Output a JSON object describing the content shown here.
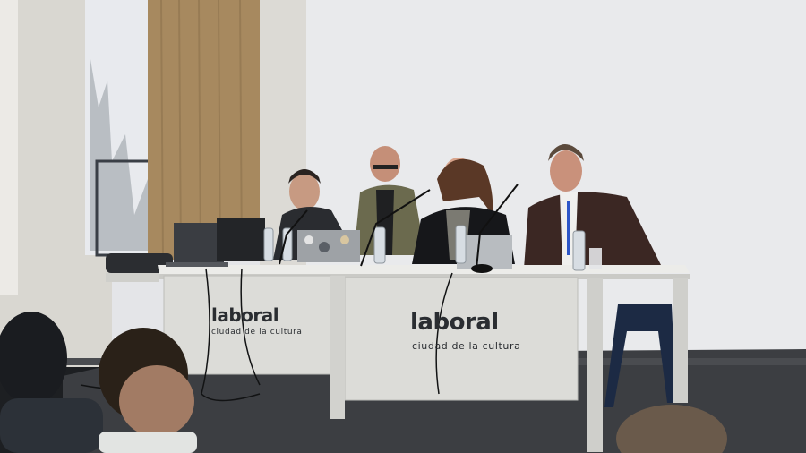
{
  "scene": {
    "banners": [
      {
        "brand": "laboral",
        "tagline": "ciudad de la cultura"
      },
      {
        "brand": "laboral",
        "tagline": "ciudad de la cultura"
      }
    ],
    "colors": {
      "wall": "#e7e8ea",
      "curtain": "#a7895f",
      "stage": "#3c3e42",
      "table": "#e2e2df",
      "banner": "#dcdcd8"
    }
  }
}
